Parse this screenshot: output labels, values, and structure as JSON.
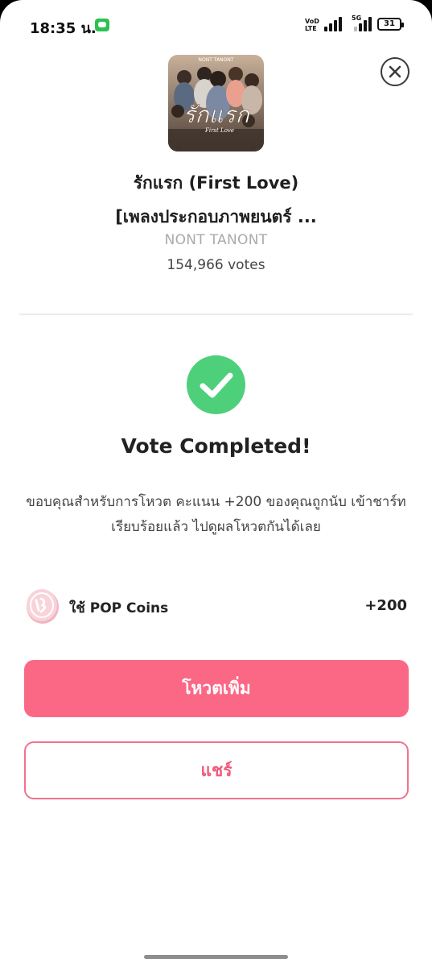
{
  "status_bar": {
    "time": "18:35 น.",
    "network_volte": "VoD LTE",
    "network_5g": "5G",
    "battery": "31"
  },
  "song": {
    "title_line1": "รักแรก (First Love)",
    "title_line2": "[เพลงประกอบภาพยนตร์ ...",
    "artist": "NONT TANONT",
    "votes": "154,966 votes",
    "cover": {
      "artist_text": "NONT TANONT",
      "title_art": "รักแรก",
      "subtitle_art": "First Love"
    }
  },
  "result": {
    "title": "Vote Completed!",
    "message": "ขอบคุณสำหรับการโหวต คะแนน +200 ของคุณถูกนับ เข้าชาร์ทเรียบร้อยแล้ว ไปดูผลโหวตกันได้เลย"
  },
  "coins": {
    "label": "ใช้ POP Coins",
    "value": "+200"
  },
  "actions": {
    "vote_more": "โหวตเพิ่ม",
    "share": "แชร์"
  },
  "colors": {
    "accent": "#fb6885",
    "success": "#4ed07a"
  }
}
